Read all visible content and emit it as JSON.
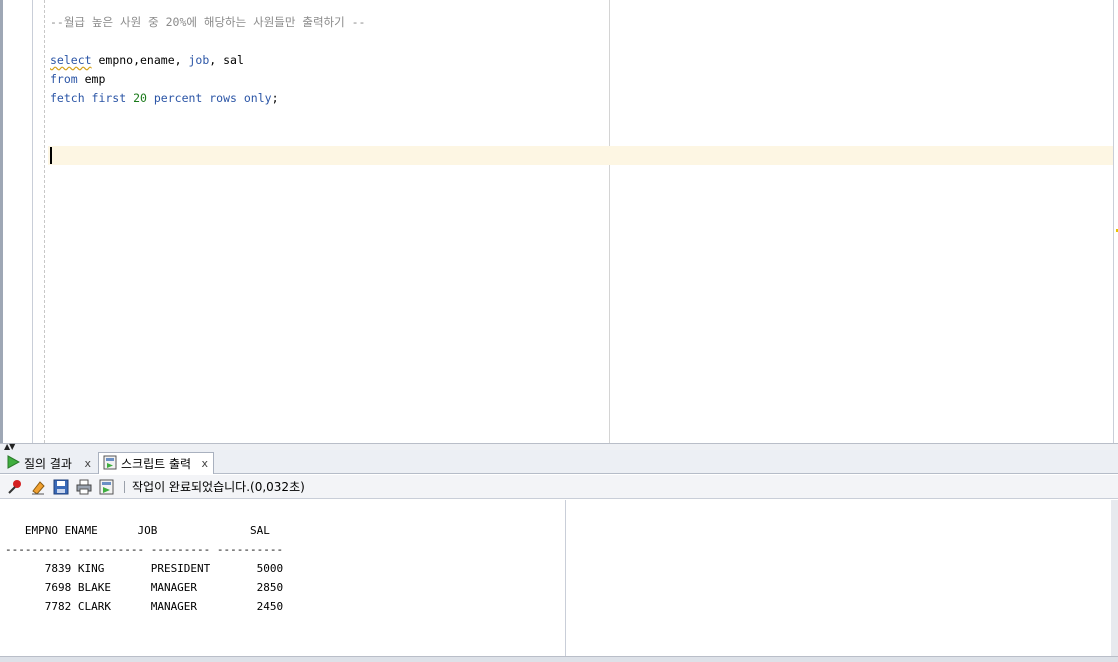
{
  "editor": {
    "comment": "--월급 높은 사원 중 20%에 해당하는 사원들만 출력하기 --",
    "line2": {
      "kw_select": "select",
      "cols": " empno,ename, ",
      "kw_job": "job",
      "rest": ", sal"
    },
    "line3": {
      "kw_from": "from",
      "rest": " emp"
    },
    "line4": {
      "kw1": "fetch first",
      "num": " 20 ",
      "kw2": "percent rows only",
      "end": ";"
    }
  },
  "tabs": [
    {
      "label": "질의 결과",
      "close": "x",
      "icon": "play-icon"
    },
    {
      "label": "스크립트 출력",
      "close": "x",
      "icon": "script-output-icon"
    }
  ],
  "toolbar": {
    "icons": [
      "pin-icon",
      "eraser-icon",
      "save-icon",
      "print-icon",
      "open-script-icon"
    ],
    "status": "작업이 완료되었습니다.(0,032초)"
  },
  "result": {
    "header": "   EMPNO ENAME      JOB              SAL",
    "rule": "---------- ---------- --------- ----------",
    "rows": [
      "      7839 KING       PRESIDENT       5000",
      "      7698 BLAKE      MANAGER         2850",
      "      7782 CLARK      MANAGER         2450"
    ]
  },
  "colors": {
    "keyword": "#2b55a6",
    "comment": "#8a8a8a",
    "number": "#1a7a1a",
    "current_line": "#fdf6e3"
  }
}
